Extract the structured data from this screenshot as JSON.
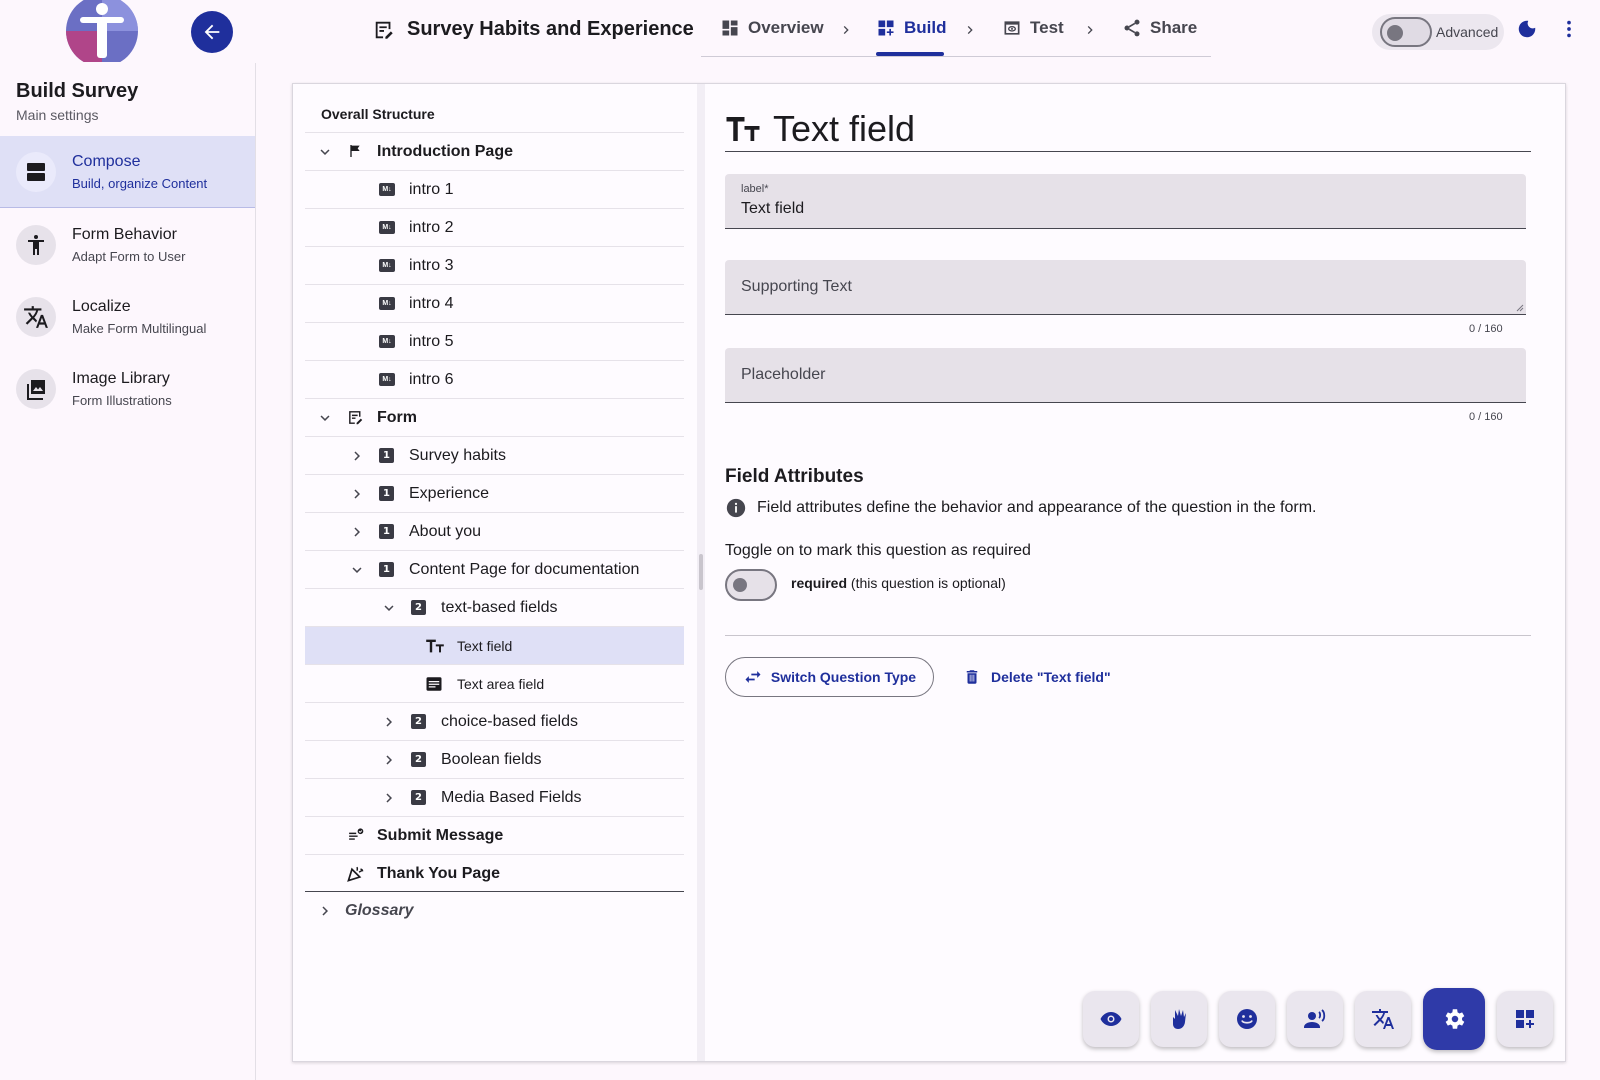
{
  "header": {
    "survey_title": "Survey Habits and Experience",
    "steps": [
      {
        "label": "Overview",
        "icon": "dashboard-icon"
      },
      {
        "label": "Build",
        "icon": "dashboard-add-icon"
      },
      {
        "label": "Test",
        "icon": "preview-icon"
      },
      {
        "label": "Share",
        "icon": "share-icon"
      }
    ],
    "active_step": "Build",
    "advanced_label": "Advanced",
    "advanced_on": false
  },
  "sidebar": {
    "title": "Build Survey",
    "subtitle": "Main settings",
    "items": [
      {
        "label": "Compose",
        "desc": "Build, organize Content",
        "icon": "view-agenda-icon",
        "active": true
      },
      {
        "label": "Form Behavior",
        "desc": "Adapt Form to User",
        "icon": "accessibility-icon",
        "active": false
      },
      {
        "label": "Localize",
        "desc": "Make Form Multilingual",
        "icon": "translate-icon",
        "active": false
      },
      {
        "label": "Image Library",
        "desc": "Form Illustrations",
        "icon": "photo-library-icon",
        "active": false
      }
    ]
  },
  "tree": {
    "heading": "Overall Structure",
    "rows": [
      {
        "label": "Introduction Page"
      },
      {
        "label": "intro 1"
      },
      {
        "label": "intro 2"
      },
      {
        "label": "intro 3"
      },
      {
        "label": "intro 4"
      },
      {
        "label": "intro 5"
      },
      {
        "label": "intro 6"
      },
      {
        "label": "Form"
      },
      {
        "label": "Survey habits",
        "badge": "1"
      },
      {
        "label": "Experience",
        "badge": "1"
      },
      {
        "label": "About you",
        "badge": "1"
      },
      {
        "label": "Content Page for documentation",
        "badge": "1"
      },
      {
        "label": "text-based fields",
        "badge": "2"
      },
      {
        "label": "Text field",
        "selected": true
      },
      {
        "label": "Text area field"
      },
      {
        "label": "choice-based fields",
        "badge": "2"
      },
      {
        "label": "Boolean fields",
        "badge": "2"
      },
      {
        "label": "Media Based Fields",
        "badge": "2"
      },
      {
        "label": "Submit Message"
      },
      {
        "label": "Thank You Page"
      },
      {
        "label": "Glossary"
      }
    ],
    "md_badge": "M↓"
  },
  "editor": {
    "title": "Text field",
    "label_field": {
      "label": "label*",
      "value": "Text field"
    },
    "supporting_text": {
      "placeholder": "Supporting Text",
      "counter": "0 / 160"
    },
    "placeholder_field": {
      "placeholder": "Placeholder",
      "counter": "0 / 160"
    },
    "attributes_title": "Field Attributes",
    "attributes_info": "Field attributes define the behavior and appearance of the question in the form.",
    "required_prompt": "Toggle on to mark this question as required",
    "required_label": "required",
    "required_note": "(this question is optional)",
    "required_on": false,
    "switch_button": "Switch Question Type",
    "delete_button": "Delete \"Text field\""
  },
  "toolbar": {
    "buttons": [
      {
        "icon": "eye-icon"
      },
      {
        "icon": "sign-language-icon"
      },
      {
        "icon": "emoji-icon"
      },
      {
        "icon": "record-voice-icon"
      },
      {
        "icon": "translate-icon"
      },
      {
        "icon": "settings-icon",
        "active": true
      },
      {
        "icon": "dashboard-add-icon"
      }
    ]
  },
  "colors": {
    "primary": "#1f2f9c",
    "active_bg": "#dfe0f6",
    "background": "#fdf7fd"
  }
}
